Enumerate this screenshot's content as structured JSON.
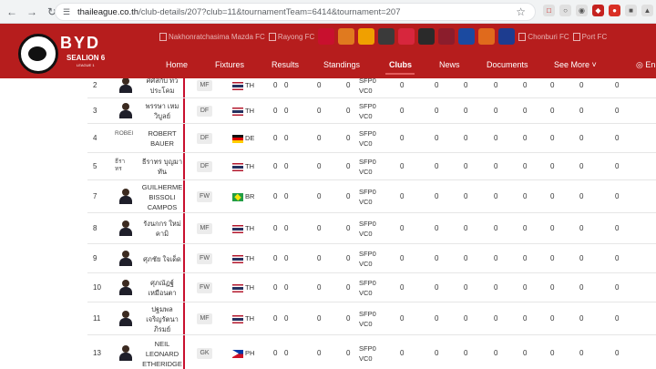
{
  "browser": {
    "url_host": "thaileague.co.th",
    "url_path": "/club-details/207?club=11&tournamentTeam=6414&tournament=207"
  },
  "site": {
    "logo": {
      "brand": "BYD",
      "name": "SEALION 6",
      "sub": "LEAGUE 1"
    },
    "club_strip": [
      {
        "type": "text",
        "label": "Nakhonratchasima Mazda FC"
      },
      {
        "type": "text",
        "label": "Rayong FC"
      },
      {
        "type": "crest",
        "color": "#c8102e"
      },
      {
        "type": "crest",
        "color": "#e07a1f"
      },
      {
        "type": "crest",
        "color": "#f0a000"
      },
      {
        "type": "crest",
        "color": "#3a3a3a"
      },
      {
        "type": "crest",
        "color": "#d7263d"
      },
      {
        "type": "crest",
        "color": "#2a2a2a"
      },
      {
        "type": "crest",
        "color": "#8b1d2c"
      },
      {
        "type": "crest",
        "color": "#1b4aa0"
      },
      {
        "type": "crest",
        "color": "#e06a1c"
      },
      {
        "type": "crest",
        "color": "#1d3c8f"
      },
      {
        "type": "text",
        "label": "Chonburi FC"
      },
      {
        "type": "text",
        "label": "Port FC"
      }
    ],
    "menu": [
      "Home",
      "Fixtures",
      "Results",
      "Standings",
      "Clubs",
      "News",
      "Documents",
      "See More",
      "En"
    ],
    "menu_active": "Clubs"
  },
  "players": [
    {
      "no": "2",
      "name": "ศศิสกับ ทว\nประโคม",
      "pos": "MF",
      "nat": "TH",
      "img": "avatar"
    },
    {
      "no": "3",
      "name": "พรรษา เหม\nวิบูลย์",
      "pos": "DF",
      "nat": "TH",
      "img": "avatar"
    },
    {
      "no": "4",
      "name": "ROBERT\nBAUER",
      "pos": "DF",
      "nat": "DE",
      "img": "broken",
      "alt": "ROBEI"
    },
    {
      "no": "5",
      "name": "ธีราทร บุญมา\nทัน",
      "pos": "DF",
      "nat": "TH",
      "img": "broken",
      "alt": "ธีรา\nทร"
    },
    {
      "no": "7",
      "name": "GUILHERME\nBISSOLI\nCAMPOS",
      "pos": "FW",
      "nat": "BR",
      "img": "avatar"
    },
    {
      "no": "8",
      "name": "รังนกกร ใหม่\nคามิ",
      "pos": "MF",
      "nat": "TH",
      "img": "avatar"
    },
    {
      "no": "9",
      "name": "ศุภชัย ใจเด็ด",
      "pos": "FW",
      "nat": "TH",
      "img": "avatar"
    },
    {
      "no": "10",
      "name": "ศุภณัฏฐ์\nเหมือนตา",
      "pos": "FW",
      "nat": "TH",
      "img": "avatar"
    },
    {
      "no": "11",
      "name": "ปฐมพล\nเจริญรัตนา\nภิรมย์",
      "pos": "MF",
      "nat": "TH",
      "img": "avatar"
    },
    {
      "no": "13",
      "name": "NEIL\nLEONARD\nETHERIDGE",
      "pos": "GK",
      "nat": "PH",
      "img": "avatar"
    }
  ],
  "stat_values": [
    "0",
    "0",
    "0",
    "0",
    "0",
    "0",
    "0",
    "0",
    "0",
    "0",
    "0",
    "0"
  ],
  "sfp_label": "SFP",
  "vc_label": "VC",
  "sfp_value": "0",
  "vc_value": "0",
  "colors": {
    "header": "#b61d1d",
    "accent": "#c8102e"
  }
}
